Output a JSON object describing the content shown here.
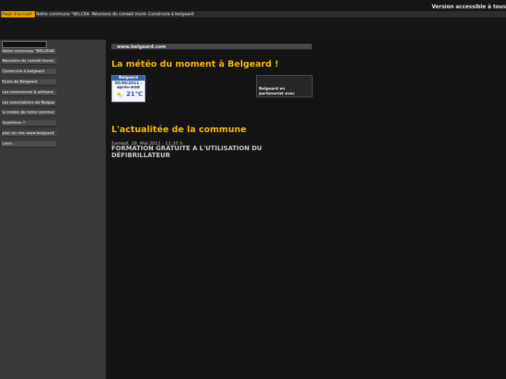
{
  "header": {
    "accessible_link": "Version accessible à tous"
  },
  "topnav": {
    "tabs": [
      {
        "label": "Page d'accueil",
        "active": true
      },
      {
        "label": "Notre commune \"BELCEAR",
        "active": false
      },
      {
        "label": "Réunions du conseil munic",
        "active": false
      },
      {
        "label": "Construire à belgeard",
        "active": false
      }
    ]
  },
  "sidebar": {
    "search_placeholder": "",
    "items": [
      {
        "label": "Notre commune \"BELCEAR"
      },
      {
        "label": "Réunions du conseil munic"
      },
      {
        "label": "Construire à belgeard"
      },
      {
        "label": "Ecole de Belgeard"
      },
      {
        "label": "Les commerces & artisans"
      },
      {
        "label": "Les associations de Belgea"
      },
      {
        "label": "la météo de notre commur"
      },
      {
        "label": "Questions ?"
      },
      {
        "label": "plan du site www.belgeard"
      },
      {
        "label": "Liens :"
      }
    ]
  },
  "main": {
    "url_label": "www.belgeard.com",
    "weather_heading": "La météo du moment à Belgeard !",
    "weather_widget": {
      "city": "Belgeard",
      "date": "05/06/2011 -",
      "period": "après-midi",
      "temperature": "21°C",
      "icon": "sun-cloud-icon"
    },
    "partner_text": "Belgeard en partenariat avec",
    "news_heading": "L'actualitée de la commune",
    "news": [
      {
        "date": "Samedi, 28. Mai 2011 - 11:35 h",
        "title": "FORMATION GRATUITE A L'UTILISATION DU DÉFIBRILLATEUR"
      }
    ]
  },
  "colors": {
    "accent": "#f2b800",
    "active_tab": "#f4a400",
    "background": "#161616",
    "sidebar": "#3a3a3a"
  }
}
